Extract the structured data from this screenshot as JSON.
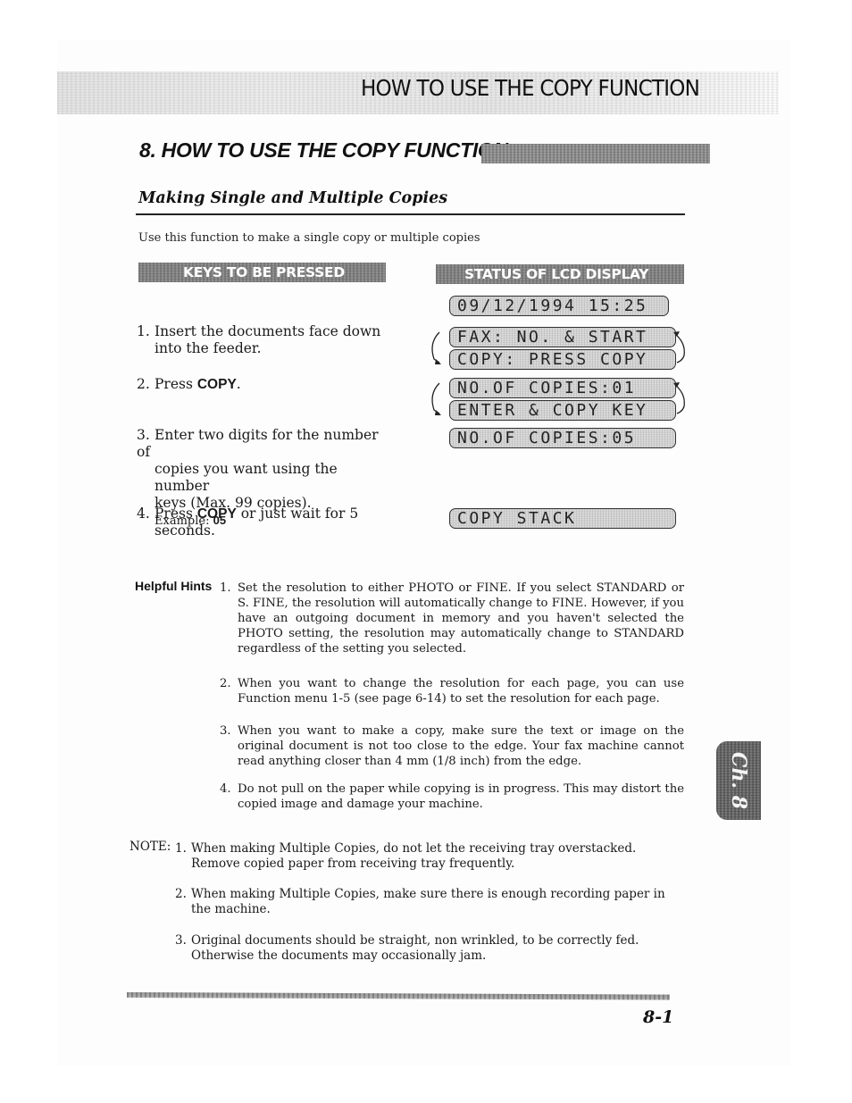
{
  "header": {
    "running_title": "HOW TO USE THE COPY FUNCTION"
  },
  "chapter": {
    "title": "8. HOW TO USE THE COPY FUNCTION",
    "tab_label": "Ch. 8"
  },
  "section": {
    "title": "Making Single and Multiple Copies",
    "intro": "Use this function to make a single copy or multiple copies"
  },
  "columns": {
    "keys_heading": "KEYS TO BE PRESSED",
    "lcd_heading": "STATUS OF LCD DISPLAY"
  },
  "steps": [
    {
      "num": "1.",
      "line1": "Insert the documents face down",
      "line2": "into the feeder."
    },
    {
      "num": "2.",
      "prefix": "Press ",
      "key": "COPY",
      "suffix": "."
    },
    {
      "num": "3.",
      "line1": "Enter two digits for the number of",
      "line2": "copies you want using the number",
      "line3": "keys (Max. 99 copies).",
      "example_label": "Example: ",
      "example_value": "05"
    },
    {
      "num": "4.",
      "prefix": "Press ",
      "key": "COPY",
      "suffix": " or just wait for 5",
      "line2": "seconds."
    }
  ],
  "lcd": {
    "date_time": "09/12/1994 15:25",
    "cycle1": [
      "FAX: NO. & START",
      "COPY: PRESS COPY"
    ],
    "cycle2": [
      "NO.OF COPIES:01",
      "ENTER & COPY KEY"
    ],
    "copies_entered": "NO.OF COPIES:05",
    "final": "COPY STACK"
  },
  "helpful_hints": {
    "label": "Helpful Hints",
    "items": [
      {
        "num": "1.",
        "text": "Set the resolution to either PHOTO or FINE. If you select STANDARD or S. FINE, the resolution will automatically change to FINE. However, if you have an outgoing document in memory and you haven't selected the PHOTO setting, the resolution may automatically change to STANDARD regardless of the setting you selected."
      },
      {
        "num": "2.",
        "text": "When you want to change the resolution for each page, you can use Function menu 1-5 (see page 6-14) to set the resolution for each page."
      },
      {
        "num": "3.",
        "text": "When you want to make a copy, make sure the text or image on the original document is not too close to the edge. Your fax machine cannot read anything closer than 4 mm (1/8 inch) from the edge."
      },
      {
        "num": "4.",
        "text": "Do not pull on the paper while copying is in progress. This may distort the copied image and damage your machine."
      }
    ]
  },
  "notes": {
    "label": "NOTE:",
    "items": [
      {
        "num": "1.",
        "text": "When making Multiple Copies, do not let the receiving tray overstacked. Remove copied paper from receiving tray frequently."
      },
      {
        "num": "2.",
        "text": "When making Multiple Copies, make sure there is enough recording paper in the machine."
      },
      {
        "num": "3.",
        "text": "Original documents should be straight, non wrinkled, to be correctly fed. Otherwise the documents may occasionally jam."
      }
    ]
  },
  "footer": {
    "page_number": "8-1"
  }
}
